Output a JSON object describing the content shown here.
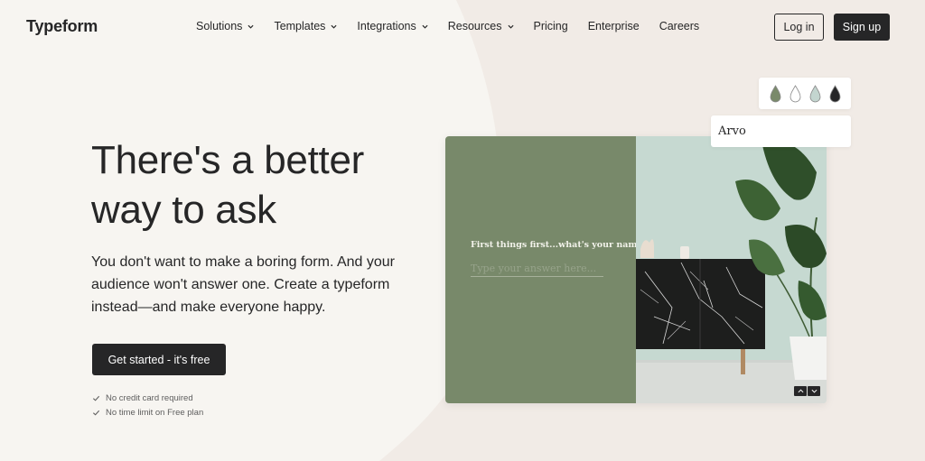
{
  "brand": {
    "logo": "Typeform"
  },
  "nav": {
    "items": [
      {
        "label": "Solutions",
        "has_dropdown": true
      },
      {
        "label": "Templates",
        "has_dropdown": true
      },
      {
        "label": "Integrations",
        "has_dropdown": true
      },
      {
        "label": "Resources",
        "has_dropdown": true
      },
      {
        "label": "Pricing",
        "has_dropdown": false
      },
      {
        "label": "Enterprise",
        "has_dropdown": false
      },
      {
        "label": "Careers",
        "has_dropdown": false
      }
    ],
    "login_label": "Log in",
    "signup_label": "Sign up"
  },
  "hero": {
    "title": "There's a better way to ask",
    "subtitle": "You don't want to make a boring form. And your audience won't answer one. Create a typeform instead—and make everyone happy.",
    "cta_label": "Get started - it's free",
    "checks": [
      "No credit card required",
      "No time limit on Free plan"
    ]
  },
  "preview": {
    "question": "First things first...what's your name?",
    "input_placeholder": "Type your answer here...",
    "panel_color": "#78896a",
    "font_name": "Arvo",
    "swatch_colors": [
      "#7a8a6b",
      "#ffffff",
      "#c3d5cf",
      "#262627"
    ]
  },
  "colors": {
    "background": "#f7f5f1",
    "dark": "#262627",
    "shape": "#f1ebe6"
  }
}
